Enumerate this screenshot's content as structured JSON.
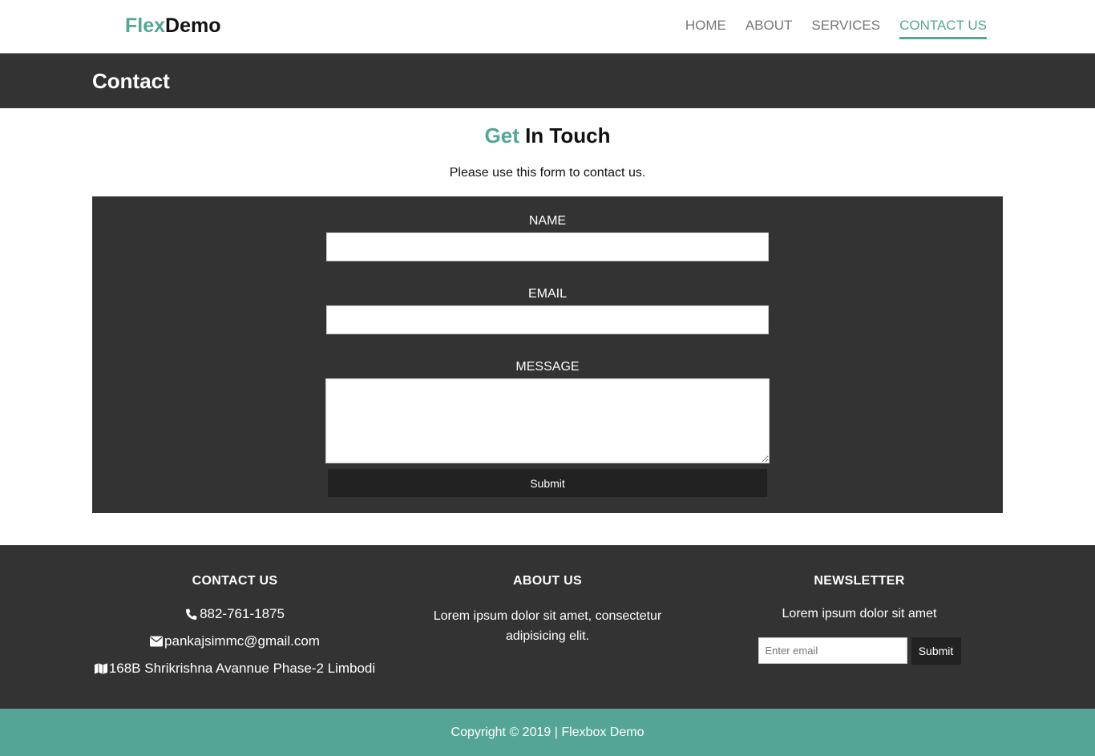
{
  "brand": {
    "part1": "Flex",
    "part2": "Demo"
  },
  "nav": {
    "items": [
      {
        "label": "HOME"
      },
      {
        "label": "ABOUT"
      },
      {
        "label": "SERVICES"
      },
      {
        "label": "CONTACT US"
      }
    ]
  },
  "banner": {
    "title": "Contact"
  },
  "heading": {
    "accent": "Get",
    "rest": " In Touch"
  },
  "subtext": "Please use this form to contact us.",
  "form": {
    "name_label": "NAME",
    "email_label": "EMAIL",
    "message_label": "MESSAGE",
    "submit_label": "Submit"
  },
  "footer": {
    "contact": {
      "title": "CONTACT US",
      "phone": "882-761-1875",
      "email": "pankajsimmc@gmail.com",
      "address": "168B Shrikrishna Avannue Phase-2 Limbodi"
    },
    "about": {
      "title": "ABOUT US",
      "text": "Lorem ipsum dolor sit amet, consectetur adipisicing elit."
    },
    "newsletter": {
      "title": "NEWSLETTER",
      "text": "Lorem ipsum dolor sit amet",
      "placeholder": "Enter email",
      "submit_label": "Submit"
    }
  },
  "copyright": "Copyright © 2019 | Flexbox Demo",
  "colors": {
    "accent": "#55a596",
    "dark": "#333333",
    "button": "#222222"
  }
}
